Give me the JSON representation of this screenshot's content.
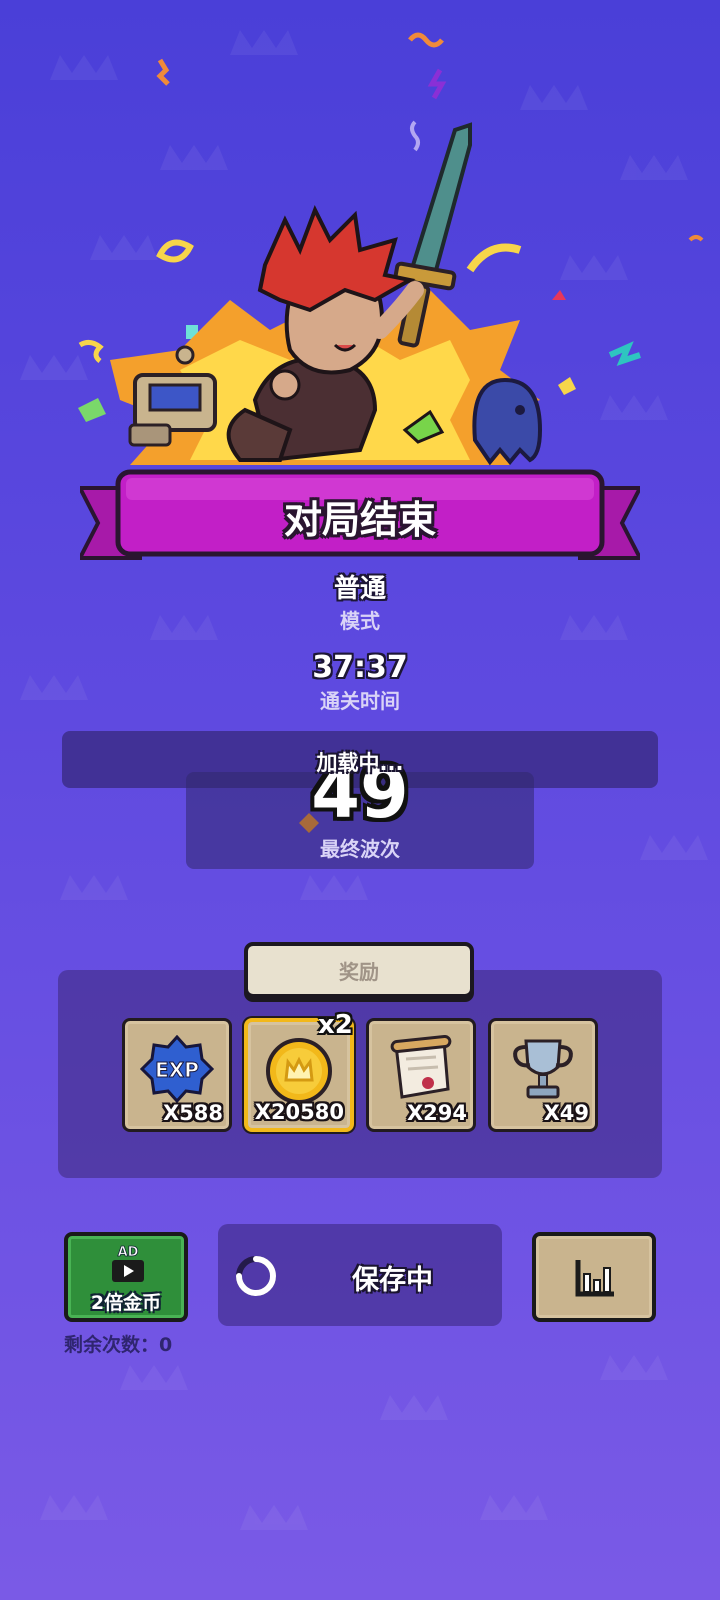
{
  "result": {
    "title": "对局结束",
    "mode_value": "普通",
    "mode_label": "模式",
    "time_value": "37:37",
    "time_label": "通关时间",
    "loading_text": "加载中...",
    "wave_value": "49",
    "wave_label": "最终波次"
  },
  "rewards": {
    "title": "奖励",
    "multiplier": "x2",
    "items": [
      {
        "icon": "exp-badge-icon",
        "qty": "X588"
      },
      {
        "icon": "gold-coin-icon",
        "qty": "X20580"
      },
      {
        "icon": "scroll-icon",
        "qty": "X294"
      },
      {
        "icon": "trophy-icon",
        "qty": "X49"
      }
    ]
  },
  "actions": {
    "ad_badge": "AD",
    "ad_label": "2倍金币",
    "remaining": "剩余次数：0",
    "save_label": "保存中",
    "stats_icon": "bar-chart-icon"
  },
  "colors": {
    "bg_top": "#4a3fd8",
    "bg_bottom": "#7a5ae6",
    "banner": "#c21fc7",
    "ad_green": "#2f8f3a",
    "card_tan": "#c9b48e",
    "gold_border": "#f2b81a"
  }
}
